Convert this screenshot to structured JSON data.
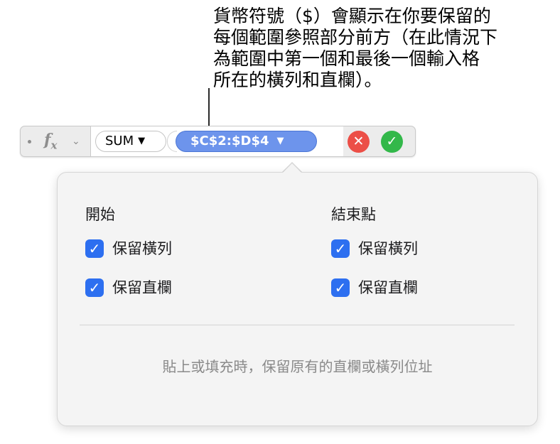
{
  "callout": {
    "lines": [
      "貨幣符號（$）會顯示在你要保留的",
      "每個範圍參照部分前方（在此情況下",
      "為範圍中第一個和最後一個輸入格",
      "所在的橫列和直欄）。"
    ]
  },
  "formula_bar": {
    "function_icon": "fx-icon",
    "function_token": "SUM",
    "range_token": "$C$2:$D$4",
    "cancel_icon": "x-icon",
    "accept_icon": "checkmark-icon",
    "colors": {
      "range_token": "#6d94ec",
      "cancel": "#ec4f47",
      "accept": "#33b84a"
    }
  },
  "popover": {
    "start": {
      "title": "開始",
      "preserve_row": {
        "label": "保留橫列",
        "checked": true
      },
      "preserve_column": {
        "label": "保留直欄",
        "checked": true
      }
    },
    "end": {
      "title": "結束點",
      "preserve_row": {
        "label": "保留橫列",
        "checked": true
      },
      "preserve_column": {
        "label": "保留直欄",
        "checked": true
      }
    },
    "footer_option": "貼上或填充時，保留原有的直欄或橫列位址",
    "checkbox_color": "#2d6ff0"
  }
}
